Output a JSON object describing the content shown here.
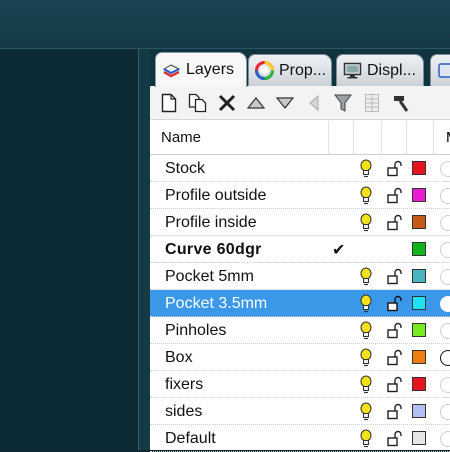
{
  "tabs": [
    {
      "label": "Layers",
      "icon": "layers-icon",
      "active": true
    },
    {
      "label": "Prop...",
      "icon": "color-wheel-icon",
      "active": false
    },
    {
      "label": "Displ...",
      "icon": "monitor-icon",
      "active": false
    }
  ],
  "toolbar": [
    {
      "name": "new-layer-button",
      "icon": "new-document-icon"
    },
    {
      "name": "new-sublayer-button",
      "icon": "copy-document-icon"
    },
    {
      "name": "delete-layer-button",
      "icon": "delete-x-icon"
    },
    {
      "name": "move-up-button",
      "icon": "triangle-up-icon"
    },
    {
      "name": "move-down-button",
      "icon": "triangle-down-icon"
    },
    {
      "name": "move-to-parent-button",
      "icon": "triangle-left-icon"
    },
    {
      "name": "filter-button",
      "icon": "funnel-icon"
    },
    {
      "name": "layer-states-button",
      "icon": "grid-icon"
    },
    {
      "name": "tools-button",
      "icon": "hammer-icon"
    }
  ],
  "header": {
    "name": "Name",
    "material": "M"
  },
  "layers": [
    {
      "name": "Stock",
      "color": "#e8141b",
      "current": false,
      "selected": false,
      "visible": true,
      "material_dark": false
    },
    {
      "name": "Profile outside",
      "color": "#e91ed3",
      "current": false,
      "selected": false,
      "visible": true,
      "material_dark": false
    },
    {
      "name": "Profile inside",
      "color": "#c85a17",
      "current": false,
      "selected": false,
      "visible": true,
      "material_dark": false
    },
    {
      "name": "Curve 60dgr",
      "color": "#11b31b",
      "current": true,
      "selected": false,
      "visible": true,
      "material_dark": false
    },
    {
      "name": "Pocket 5mm",
      "color": "#48b4bd",
      "current": false,
      "selected": false,
      "visible": true,
      "material_dark": false
    },
    {
      "name": "Pocket 3.5mm",
      "color": "#1de2f4",
      "current": false,
      "selected": true,
      "visible": true,
      "material_dark": false
    },
    {
      "name": "Pinholes",
      "color": "#78ea1f",
      "current": false,
      "selected": false,
      "visible": true,
      "material_dark": false
    },
    {
      "name": "Box",
      "color": "#f07d11",
      "current": false,
      "selected": false,
      "visible": true,
      "material_dark": true
    },
    {
      "name": "fixers",
      "color": "#e8141b",
      "current": false,
      "selected": false,
      "visible": true,
      "material_dark": false
    },
    {
      "name": "sides",
      "color": "#b5bdf5",
      "current": false,
      "selected": false,
      "visible": true,
      "material_dark": false
    },
    {
      "name": "Default",
      "color": "#e6e6e6",
      "current": false,
      "selected": false,
      "visible": true,
      "material_dark": false
    }
  ],
  "colors": {
    "selection": "#3b98e8",
    "bulb": "#f2e21c",
    "background": "#0f2c36"
  }
}
